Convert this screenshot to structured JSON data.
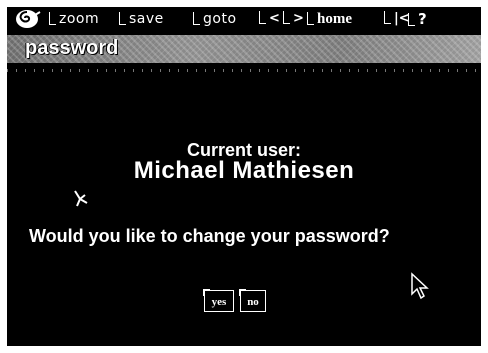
{
  "toolbar": {
    "logo_icon": "spiral-logo-icon",
    "zoom": "zoom",
    "save": "save",
    "goto": "goto",
    "prev": "<",
    "next": ">",
    "home": "home",
    "first": "|<",
    "help": "?"
  },
  "header": {
    "title": "password"
  },
  "main": {
    "current_user_label": "Current user:",
    "current_user_name": "Michael  Mathiesen",
    "question": "Would you like to change your password?",
    "yes_label": "yes",
    "no_label": "no",
    "decor_icon": "sparkle-icon",
    "cursor_icon": "mouse-pointer-icon"
  }
}
